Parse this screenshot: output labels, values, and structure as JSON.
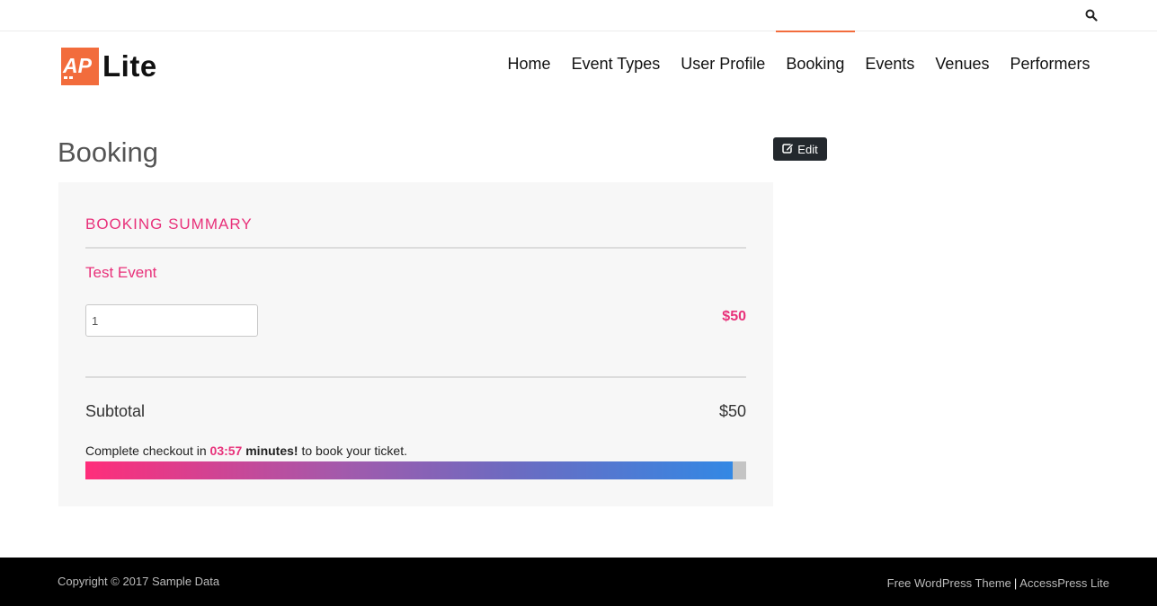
{
  "topbar": {
    "search_icon": "search-icon"
  },
  "logo": {
    "mark_text": "AP",
    "text": "Lite",
    "brand_color": "#f26c3c"
  },
  "nav": {
    "items": [
      {
        "label": "Home",
        "active": false
      },
      {
        "label": "Event Types",
        "active": false
      },
      {
        "label": "User Profile",
        "active": false
      },
      {
        "label": "Booking",
        "active": true
      },
      {
        "label": "Events",
        "active": false
      },
      {
        "label": "Venues",
        "active": false
      },
      {
        "label": "Performers",
        "active": false
      }
    ]
  },
  "page": {
    "title": "Booking",
    "edit_label": "Edit",
    "edit_icon": "edit-icon"
  },
  "summary": {
    "heading": "BOOKING SUMMARY",
    "event_name": "Test Event",
    "quantity": "1",
    "price": "$50",
    "subtotal_label": "Subtotal",
    "subtotal_value": "$50",
    "checkout_prefix": "Complete checkout in",
    "timer": "03:57",
    "timer_unit": "minutes!",
    "checkout_suffix": "to book your ticket.",
    "progress_fraction": 0.98
  },
  "colors": {
    "accent": "#e8317a",
    "brand": "#f26c3c",
    "footer_bg": "#000000",
    "edit_bg": "#23282d"
  },
  "footer": {
    "copyright": "Copyright © 2017 Sample Data",
    "credit_left": "Free WordPress Theme",
    "separator": "|",
    "credit_right": "AccessPress Lite"
  }
}
